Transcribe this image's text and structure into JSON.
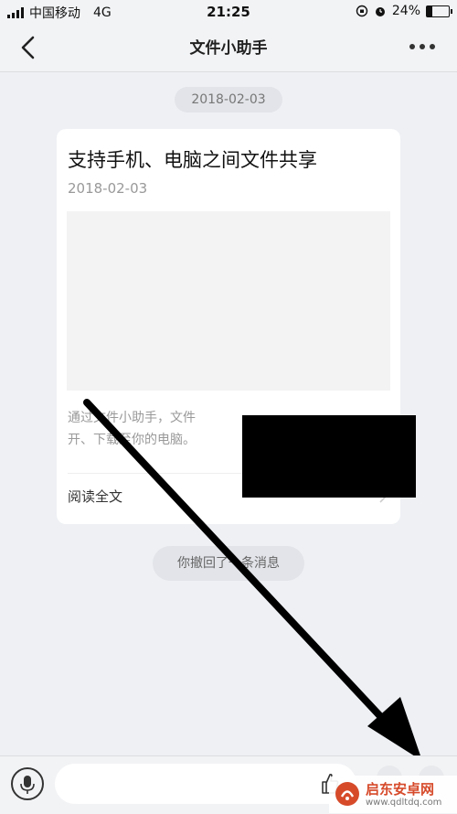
{
  "status_bar": {
    "carrier": "中国移动",
    "network": "4G",
    "time": "21:25",
    "battery_percent": "24%",
    "battery_level": 0.24
  },
  "nav": {
    "title": "文件小助手",
    "back_icon": "chevron-left-icon",
    "more_icon": "more-dots-icon"
  },
  "chat": {
    "date_divider": "2018-02-03",
    "card": {
      "title": "支持手机、电脑之间文件共享",
      "date": "2018-02-03",
      "description": "通过文件小助手，文件\n开、下载至你的电脑。",
      "read_all": "阅读全文"
    },
    "recall_notice": "你撤回了一条消息"
  },
  "input_bar": {
    "voice_icon": "microphone-icon",
    "text_value": "",
    "thumb_icon": "thumbs-up-icon",
    "emoji_icon": "emoji-icon",
    "plus_icon": "plus-icon"
  },
  "watermark": {
    "name": "启东安卓网",
    "url": "www.qdltdq.com"
  },
  "colors": {
    "background": "#eef0f4",
    "card": "#ffffff",
    "arrow": "#000000",
    "watermark_accent": "#d64a2a"
  }
}
